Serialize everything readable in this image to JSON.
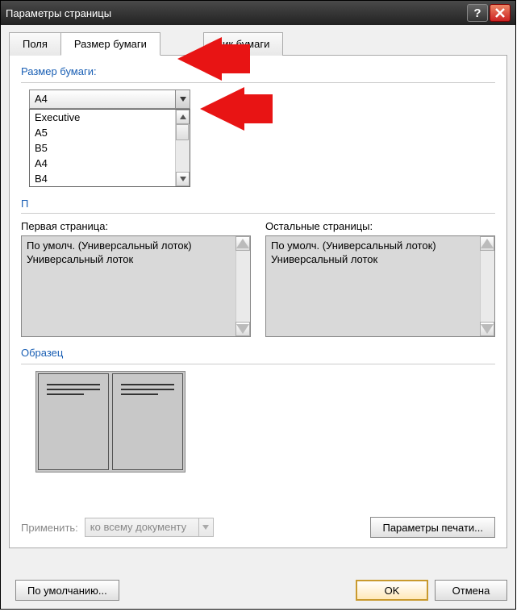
{
  "titlebar": {
    "title": "Параметры страницы"
  },
  "tabs": {
    "fields": "Поля",
    "paper_size": "Размер бумаги",
    "source_partial": "ник бумаги"
  },
  "paper": {
    "group_label": "Размер бумаги:",
    "selected": "A4",
    "options": [
      "Executive",
      "A5",
      "B5",
      "A4",
      "B4"
    ]
  },
  "trays": {
    "partial_label": "П",
    "first_label": "Первая страница:",
    "other_label": "Остальные страницы:",
    "first_items": [
      "По умолч. (Универсальный лоток)",
      "Универсальный лоток"
    ],
    "other_items": [
      "По умолч. (Универсальный лоток)",
      "Универсальный лоток"
    ]
  },
  "sample": {
    "label": "Образец"
  },
  "apply": {
    "label": "Применить:",
    "value": "ко всему документу"
  },
  "buttons": {
    "print_params": "Параметры печати...",
    "default": "По умолчанию...",
    "ok": "OK",
    "cancel": "Отмена"
  }
}
